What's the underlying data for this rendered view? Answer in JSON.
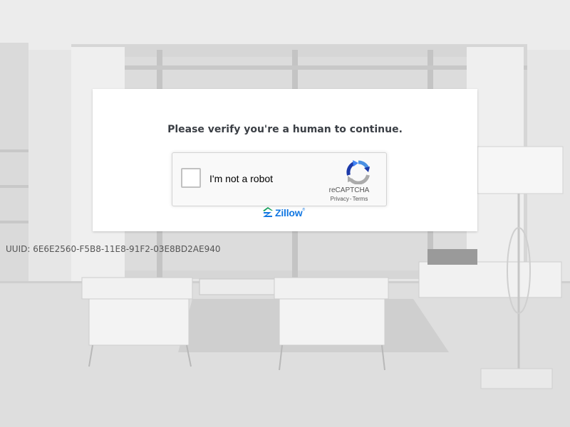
{
  "card": {
    "title": "Please verify you're a human to continue."
  },
  "recaptcha": {
    "checkbox_label": "I'm not a robot",
    "brand": "reCAPTCHA",
    "privacy_link": "Privacy",
    "separator": "-",
    "terms_link": "Terms",
    "logo_icon": "recaptcha-logo-icon"
  },
  "zillow": {
    "wordmark": "Zillow",
    "trademark": "®",
    "icon": "zillow-z-icon",
    "color": "#1277e1"
  },
  "uuid": "UUID: 6E6E2560-F5B8-11E8-91F2-03E8BD2AE940"
}
